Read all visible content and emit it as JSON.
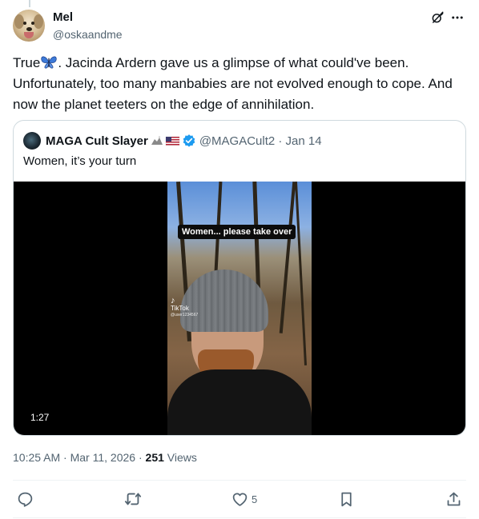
{
  "author": {
    "name": "Mel",
    "handle": "@oskaandme"
  },
  "tweet": {
    "lines": [
      "True",
      ". Jacinda Ardern gave us a glimpse of what could've been.",
      "Unfortunately, too many manbabies are not evolved enough to cope. And",
      "now the planet teeters on the edge of annihilation."
    ]
  },
  "quote": {
    "name": "MAGA Cult Slayer",
    "handle_date": "@MAGACult2 · Jan 14",
    "text": "Women, it’s your turn",
    "video": {
      "caption": "Women... please take over",
      "watermark": "TikTok",
      "watermark_sub": "@user1234567",
      "duration": "1:27"
    }
  },
  "meta": {
    "time": "10:25 AM",
    "date": "Mar 11, 2026",
    "views_count": "251",
    "views_label": "Views"
  },
  "actions": {
    "like_count": "5"
  },
  "icons": [
    "grok-icon",
    "more-icon",
    "butterfly-icon",
    "verified-icon",
    "reply-icon",
    "retweet-icon",
    "like-icon",
    "bookmark-icon",
    "share-icon"
  ],
  "colors": {
    "text": "#0f1419",
    "muted": "#536471",
    "verified": "#1d9bf0",
    "border": "#cfd9de"
  }
}
